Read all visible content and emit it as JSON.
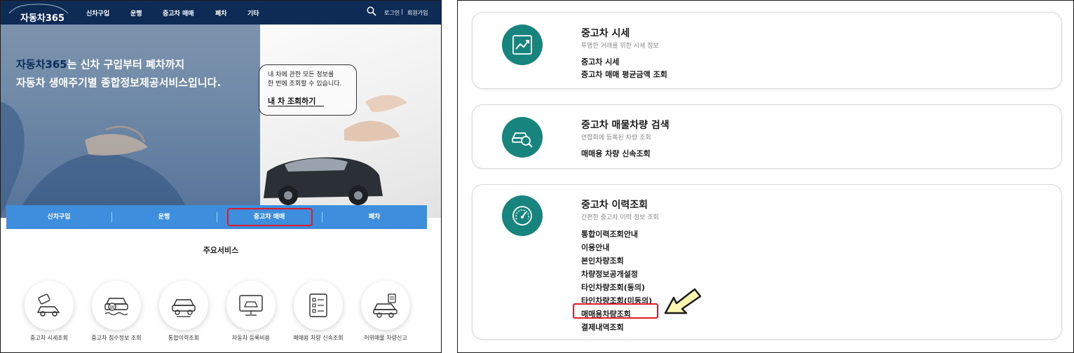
{
  "left": {
    "brand": "자동차365",
    "nav": [
      "신차구입",
      "운행",
      "중고차 매매",
      "폐차",
      "기타"
    ],
    "util": {
      "login": "로그인",
      "separator": "|",
      "signup": "회원가입"
    },
    "hero": {
      "line1_accent": "자동차365",
      "line1_rest": "는 신차 구입부터 폐차까지",
      "line2": "자동차 생애주기별 종합정보제공서비스입니다.",
      "bubble_text_1": "내 차에 관한 모든 정보를",
      "bubble_text_2": "한 번에 조회할 수 있습니다.",
      "bubble_cta": "내 차 조회하기"
    },
    "tabs": [
      "신차구입",
      "운행",
      "중고차 매매",
      "폐차"
    ],
    "highlighted_tab": "중고차 매매",
    "section_title": "주요서비스",
    "services": [
      {
        "label": "중고차 시세조회",
        "icon": "price-tag-car-icon"
      },
      {
        "label": "중고차 침수정보 조회",
        "icon": "flood-car-icon"
      },
      {
        "label": "통합이력조회",
        "icon": "car-repair-history-icon"
      },
      {
        "label": "자동차 등록비용",
        "icon": "monitor-car-registration-icon"
      },
      {
        "label": "매매용 차량 신속조회",
        "icon": "checklist-document-icon"
      },
      {
        "label": "허위매물 차량신고",
        "icon": "car-report-icon"
      }
    ]
  },
  "right": {
    "cards": [
      {
        "title": "중고차 시세",
        "subtitle": "투명한 거래를 위한 시세 정보",
        "icon": "trend-chart-icon",
        "links": [
          "중고차 시세",
          "중고차 매매 평균금액 조회"
        ]
      },
      {
        "title": "중고차 매물차량 검색",
        "subtitle": "연합회에 등록된 차량 조회",
        "icon": "car-search-icon",
        "links": [
          "매매용 차량 신속조회"
        ]
      },
      {
        "title": "중고차 이력조회",
        "subtitle": "간편한 중고차 이력 정보 조회",
        "icon": "speedometer-icon",
        "links": [
          "통합이력조회안내",
          "이용안내",
          "본인차량조회",
          "차량정보공개설정",
          "타인차량조회(동의)",
          "타인차량조회(미동의)",
          "매매용차량조회",
          "결제내역조회"
        ]
      }
    ],
    "highlighted_link": "매매용차량조회"
  },
  "colors": {
    "topbar": "#0d2b54",
    "tabbar": "#3d8fdd",
    "highlight": "#e01a2a",
    "icon_teal": "#17857d",
    "arrow_fill": "#fff6b0"
  }
}
